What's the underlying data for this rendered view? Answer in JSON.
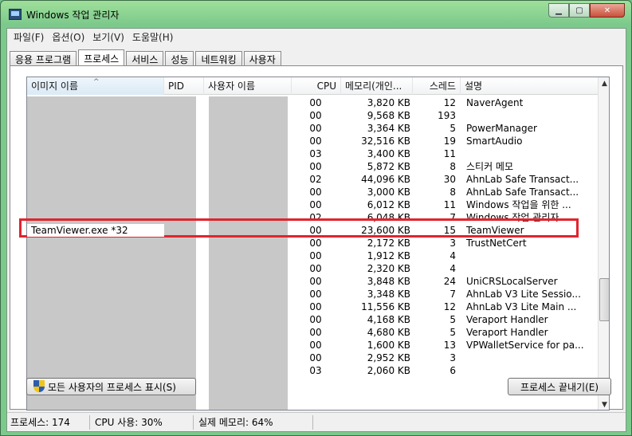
{
  "window": {
    "title": "Windows 작업 관리자"
  },
  "menu": [
    "파일(F)",
    "옵션(O)",
    "보기(V)",
    "도움말(H)"
  ],
  "tabs": [
    "응용 프로그램",
    "프로세스",
    "서비스",
    "성능",
    "네트워킹",
    "사용자"
  ],
  "columns": {
    "image": "이미지 이름",
    "pid": "PID",
    "user": "사용자 이름",
    "cpu": "CPU",
    "memory": "메모리(개인...",
    "threads": "스레드",
    "description": "설명"
  },
  "rows": [
    {
      "image": "",
      "cpu": "00",
      "mem": "3,820 KB",
      "thr": "12",
      "desc": "NaverAgent"
    },
    {
      "image": "",
      "cpu": "00",
      "mem": "9,568 KB",
      "thr": "193",
      "desc": ""
    },
    {
      "image": "",
      "cpu": "00",
      "mem": "3,364 KB",
      "thr": "5",
      "desc": "PowerManager"
    },
    {
      "image": "",
      "cpu": "00",
      "mem": "32,516 KB",
      "thr": "19",
      "desc": "SmartAudio"
    },
    {
      "image": "",
      "cpu": "03",
      "mem": "3,400 KB",
      "thr": "11",
      "desc": ""
    },
    {
      "image": "",
      "cpu": "00",
      "mem": "5,872 KB",
      "thr": "8",
      "desc": "스티커 메모"
    },
    {
      "image": "",
      "cpu": "02",
      "mem": "44,096 KB",
      "thr": "30",
      "desc": "AhnLab Safe Transact..."
    },
    {
      "image": "",
      "cpu": "00",
      "mem": "3,000 KB",
      "thr": "8",
      "desc": "AhnLab Safe Transact..."
    },
    {
      "image": "",
      "cpu": "00",
      "mem": "6,012 KB",
      "thr": "11",
      "desc": "Windows 작업을 위한 ..."
    },
    {
      "image": "",
      "cpu": "02",
      "mem": "6,048 KB",
      "thr": "7",
      "desc": "Windows 작업 관리자"
    },
    {
      "image": "TeamViewer.exe *32",
      "cpu": "00",
      "mem": "23,600 KB",
      "thr": "15",
      "desc": "TeamViewer"
    },
    {
      "image": "",
      "cpu": "00",
      "mem": "2,172 KB",
      "thr": "3",
      "desc": "TrustNetCert"
    },
    {
      "image": "",
      "cpu": "00",
      "mem": "1,912 KB",
      "thr": "4",
      "desc": ""
    },
    {
      "image": "",
      "cpu": "00",
      "mem": "2,320 KB",
      "thr": "4",
      "desc": ""
    },
    {
      "image": "",
      "cpu": "00",
      "mem": "3,848 KB",
      "thr": "24",
      "desc": "UniCRSLocalServer"
    },
    {
      "image": "",
      "cpu": "00",
      "mem": "3,348 KB",
      "thr": "7",
      "desc": "AhnLab V3 Lite Sessio..."
    },
    {
      "image": "",
      "cpu": "00",
      "mem": "11,556 KB",
      "thr": "12",
      "desc": "AhnLab V3 Lite Main ..."
    },
    {
      "image": "",
      "cpu": "00",
      "mem": "4,168 KB",
      "thr": "5",
      "desc": "Veraport Handler"
    },
    {
      "image": "",
      "cpu": "00",
      "mem": "4,680 KB",
      "thr": "5",
      "desc": "Veraport Handler"
    },
    {
      "image": "",
      "cpu": "00",
      "mem": "1,600 KB",
      "thr": "13",
      "desc": "VPWalletService for pa..."
    },
    {
      "image": "",
      "cpu": "00",
      "mem": "2,952 KB",
      "thr": "3",
      "desc": ""
    },
    {
      "image": "",
      "cpu": "03",
      "mem": "2,060 KB",
      "thr": "6",
      "desc": ""
    }
  ],
  "buttons": {
    "show_all": "모든 사용자의 프로세스 표시(S)",
    "end_process": "프로세스 끝내기(E)"
  },
  "status": {
    "processes": "프로세스: 174",
    "cpu": "CPU 사용: 30%",
    "memory": "실제 메모리: 64%"
  },
  "colors": {
    "highlight": "#e1242e",
    "titlebar": "#7cc98c"
  }
}
